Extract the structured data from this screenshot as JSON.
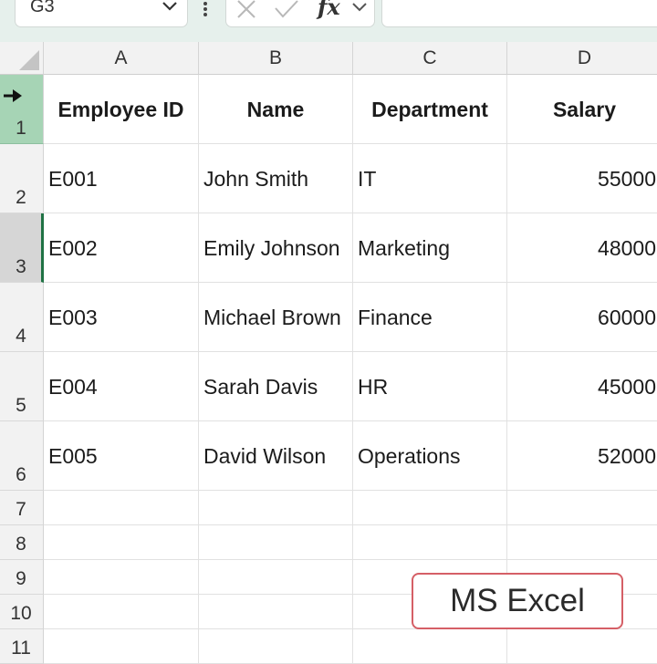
{
  "formula_bar": {
    "name_box": "G3",
    "formula_value": ""
  },
  "icons": {
    "name_box_dropdown": "chevron-down-icon",
    "more_options": "vertical-dots-icon",
    "cancel": "x-icon",
    "enter": "check-icon",
    "insert_function": "fx-icon",
    "fx_dropdown": "chevron-down-icon",
    "select_all": "corner-triangle-icon",
    "row_selected": "arrow-right-icon"
  },
  "fx_label": "fx",
  "columns": [
    "A",
    "B",
    "C",
    "D"
  ],
  "rows": [
    "1",
    "2",
    "3",
    "4",
    "5",
    "6",
    "7",
    "8",
    "9",
    "10",
    "11"
  ],
  "table": {
    "headers": [
      "Employee ID",
      "Name",
      "Department",
      "Salary"
    ],
    "records": [
      {
        "id": "E001",
        "name": "John Smith",
        "department": "IT",
        "salary": "55000"
      },
      {
        "id": "E002",
        "name": "Emily Johnson",
        "department": "Marketing",
        "salary": "48000"
      },
      {
        "id": "E003",
        "name": "Michael Brown",
        "department": "Finance",
        "salary": "60000"
      },
      {
        "id": "E004",
        "name": "Sarah Davis",
        "department": "HR",
        "salary": "45000"
      },
      {
        "id": "E005",
        "name": "David Wilson",
        "department": "Operations",
        "salary": "52000"
      }
    ]
  },
  "watermark": "MS Excel",
  "colors": {
    "accent_green": "#1f7244",
    "selected_row_header": "#a6d4b5",
    "watermark_border": "#d55f66"
  }
}
